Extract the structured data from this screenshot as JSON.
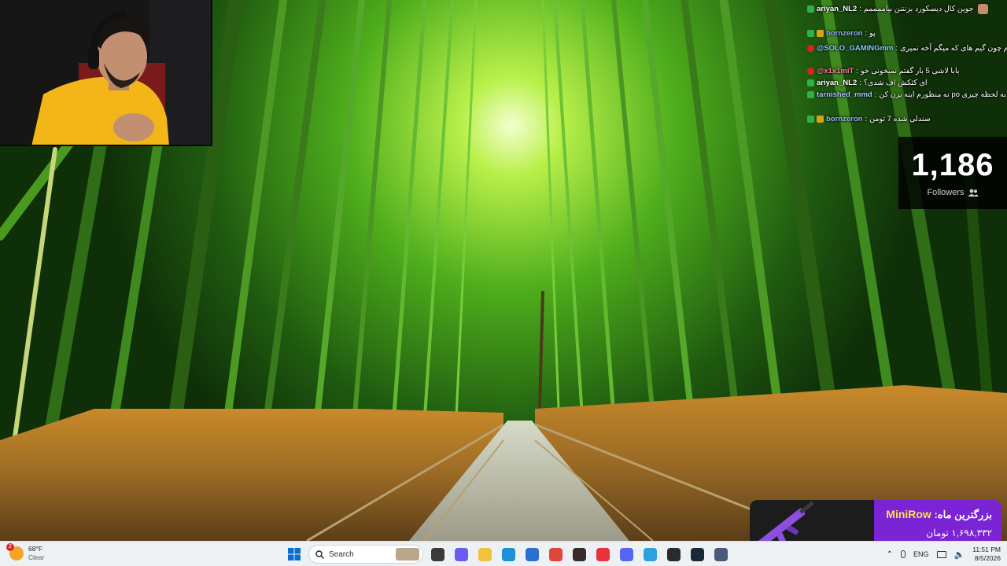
{
  "chat": {
    "messages": [
      {
        "badge": "mod",
        "user": "ariyan_NL2",
        "sep": " : ",
        "text": "جوین کال دیسکورد بزنننن بیاممممم"
      },
      {
        "badge": "sub",
        "user": "bornzeron",
        "sep": " : ",
        "text": "پو"
      },
      {
        "badge": "yt",
        "user": "@SOLO_GAMINGmm",
        "sep": " : ",
        "text": "ازشیا امتیاز هم بدم چون گیم های که میگم آخه نمیری"
      },
      {
        "badge": "yt",
        "user": "@x1x1miT",
        "sep": " : ",
        "text": "بابا لاشی 5 بار گفتم نمیخونی خو"
      },
      {
        "badge": "mod",
        "user": "ariyan_NL2",
        "sep": " : ",
        "text": "ای کثکش اف شدی؟"
      },
      {
        "badge": "mod",
        "user": "tarnished_mmd",
        "sep": " : ",
        "text": "وایسا به لحظه چیزی po نه منظورم اینه بزن کن"
      },
      {
        "badge": "sub",
        "user": "bornzeron",
        "sep": " : ",
        "text": "صندلی شده 7 تومن"
      }
    ]
  },
  "followers": {
    "count": "1,186",
    "label": "Followers"
  },
  "top_donor": {
    "title": "بزرگترین ماه:",
    "name": "MiniRow",
    "amount": "۱,۶۹۸,۳۳۲ تومان"
  },
  "taskbar": {
    "weather": {
      "badge_count": "2",
      "temp": "68°F",
      "condition": "Clear"
    },
    "search_placeholder": "Search",
    "pinned": [
      {
        "icon": "task-view-icon",
        "color": "#3a3a3a"
      },
      {
        "icon": "copilot-icon",
        "color": "#6a5cf0"
      },
      {
        "icon": "file-explorer-icon",
        "color": "#f2c23a"
      },
      {
        "icon": "edge-icon",
        "color": "#1f8fd6"
      },
      {
        "icon": "store-icon",
        "color": "#2a6fd2"
      },
      {
        "icon": "chrome-icon",
        "color": "#e0463a"
      },
      {
        "icon": "obs-icon",
        "color": "#3a2a2a"
      },
      {
        "icon": "valorant-icon",
        "color": "#e8323c"
      },
      {
        "icon": "discord-icon",
        "color": "#5865f2"
      },
      {
        "icon": "telegram-icon",
        "color": "#2aa2e0"
      },
      {
        "icon": "app-icon",
        "color": "#2b2b2b"
      },
      {
        "icon": "steam-icon",
        "color": "#1b2838"
      },
      {
        "icon": "settings-app-icon",
        "color": "#4a5a7a"
      }
    ],
    "tray": {
      "language": "ENG",
      "time": "11:51 PM",
      "date": "8/5/2026"
    }
  }
}
